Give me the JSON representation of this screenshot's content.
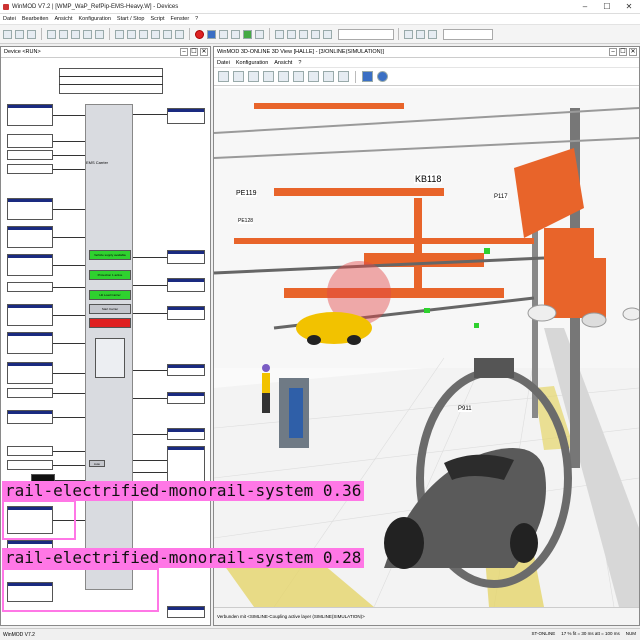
{
  "window": {
    "title": "WinMOD V7.2 | [WMP_WaP_RefPip-EMS-Heavy.W] - Devices",
    "controls": [
      "–",
      "☐",
      "✕"
    ]
  },
  "menubar": [
    "Datei",
    "Bearbeiten",
    "Ansicht",
    "Konfiguration",
    "Start / Stop",
    "Script",
    "Fenster",
    "?"
  ],
  "devices_window": {
    "title": "Device <RUN>",
    "center_block_title": "EMS Carrier",
    "buttons": [
      "Vehicle supply available",
      "Protection 1 active",
      "Hit Load Carrier",
      "Start Carrier",
      ""
    ],
    "bottom_button": "Auto"
  },
  "view_window": {
    "title": "WinMOD 3D-ONLINE 3D View [HALLE] - [3/ONLINE(SIMULATION)]",
    "menu": [
      "Datei",
      "Konfiguration",
      "Ansicht",
      "?"
    ],
    "status": "Verbunden mit <SIMLINE-Coupling active layer (SIMLINE(SIMULATION)>",
    "labels": {
      "kb118": "KB118",
      "pe119": "PE119",
      "pe128": "PE128",
      "p117": "P117",
      "p911": "P911"
    }
  },
  "statusbar": {
    "left": "WinMOD V7.2",
    "mode": "ST-ONLINE",
    "timing": "17 % fit = 30 ms  att = 100 ms",
    "code": "NUM"
  },
  "detections": [
    {
      "label": "rail-electrified-monorail-system 0.36"
    },
    {
      "label": "rail-electrified-monorail-system 0.28"
    }
  ],
  "colors": {
    "detection": "#ff77e6",
    "ems_orange": "#e8642a",
    "car_yellow": "#f2c200",
    "car_grey": "#5a5a5a",
    "button_green": "#2fd12f",
    "button_red": "#e02020"
  }
}
